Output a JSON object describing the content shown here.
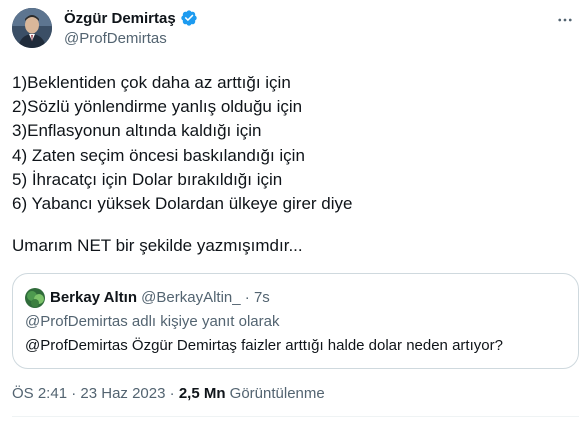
{
  "author": {
    "display_name": "Özgür Demirtaş",
    "handle": "@ProfDemirtas",
    "verified_color": "#1d9bf0"
  },
  "tweet": {
    "lines": [
      "1)Beklentiden çok daha az arttığı için",
      "2)Sözlü yönlendirme yanlış olduğu için",
      "3)Enflasyonun altında kaldığı için",
      "4) Zaten seçim öncesi baskılandığı için",
      "5) İhracatçı için Dolar bırakıldığı için",
      "6) Yabancı yüksek Dolardan ülkeye girer diye"
    ],
    "closing": "Umarım NET bir şekilde yazmışımdır..."
  },
  "quoted": {
    "display_name": "Berkay Altın",
    "handle": "@BerkayAltin_",
    "dot": "·",
    "time": "7s",
    "reply_context": "@ProfDemirtas adlı kişiye yanıt olarak",
    "text": "@ProfDemirtas Özgür Demirtaş faizler arttığı halde dolar neden artıyor?"
  },
  "meta": {
    "time": "ÖS 2:41",
    "separator": "·",
    "date": "23 Haz 2023",
    "views_count": "2,5 Mn",
    "views_label": "Görüntülenme"
  },
  "icons": {
    "more": "more-horizontal-icon",
    "verified": "verified-badge-icon"
  }
}
